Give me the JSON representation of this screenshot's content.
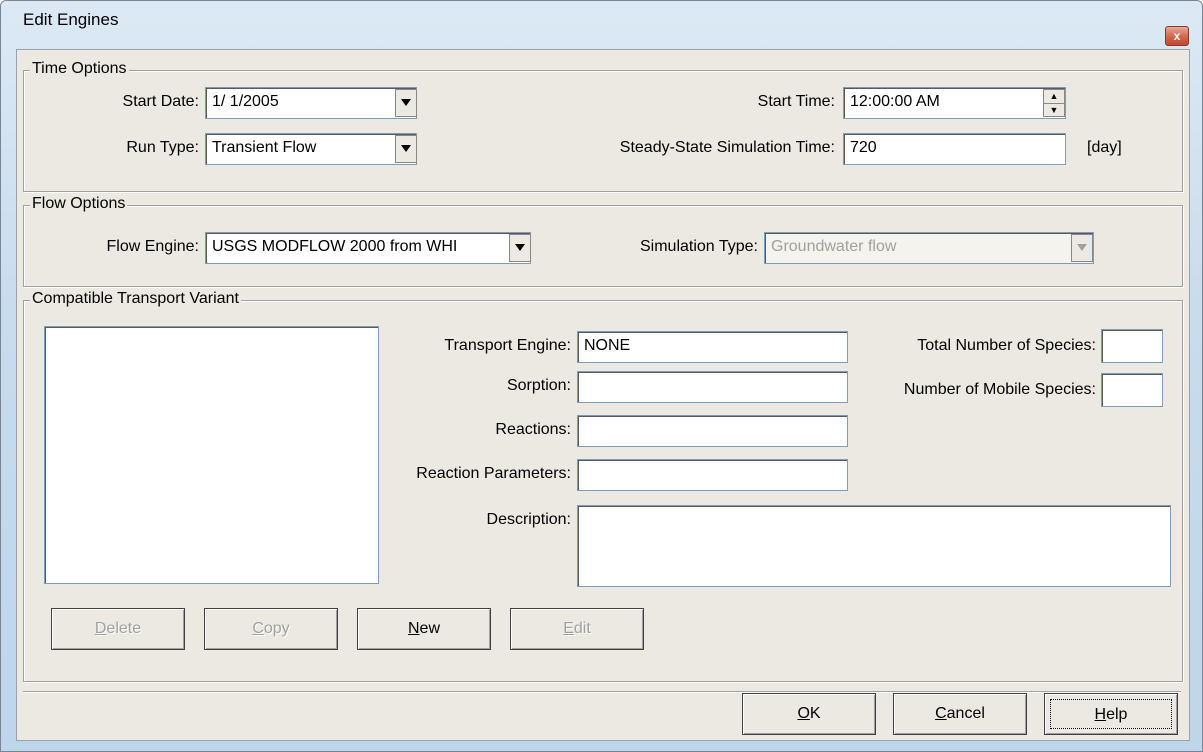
{
  "window": {
    "title": "Edit Engines",
    "close_glyph": "x"
  },
  "time_options": {
    "title": "Time Options",
    "start_date_label": "Start Date:",
    "start_date_value": "1/ 1/2005",
    "run_type_label": "Run Type:",
    "run_type_value": "Transient Flow",
    "start_time_label": "Start Time:",
    "start_time_value": "12:00:00 AM",
    "steady_state_label": "Steady-State Simulation Time:",
    "steady_state_value": "720",
    "steady_state_unit": "[day]"
  },
  "flow_options": {
    "title": "Flow Options",
    "flow_engine_label": "Flow Engine:",
    "flow_engine_value": "USGS MODFLOW 2000 from WHI",
    "simulation_type_label": "Simulation Type:",
    "simulation_type_value": "Groundwater flow"
  },
  "transport": {
    "title": "Compatible Transport Variant",
    "transport_engine_label": "Transport Engine:",
    "transport_engine_value": "NONE",
    "sorption_label": "Sorption:",
    "sorption_value": "",
    "reactions_label": "Reactions:",
    "reactions_value": "",
    "reaction_parameters_label": "Reaction Parameters:",
    "reaction_parameters_value": "",
    "description_label": "Description:",
    "description_value": "",
    "total_species_label": "Total Number of Species:",
    "total_species_value": "",
    "mobile_species_label": "Number of Mobile Species:",
    "mobile_species_value": "",
    "buttons": {
      "delete": {
        "mn": "D",
        "rest": "elete"
      },
      "copy": {
        "mn": "C",
        "rest": "opy"
      },
      "new": {
        "mn": "N",
        "rest": "ew"
      },
      "edit": {
        "mn": "E",
        "rest": "dit"
      }
    }
  },
  "footer": {
    "ok": {
      "mn": "O",
      "rest": "K"
    },
    "cancel": {
      "mn": "C",
      "rest": "ancel"
    },
    "help": {
      "mn": "H",
      "rest": "elp"
    }
  },
  "colors": {
    "accent_close": "#c2472f",
    "dialog_bg": "#ebe9e1",
    "field_border": "#7f9db9"
  }
}
